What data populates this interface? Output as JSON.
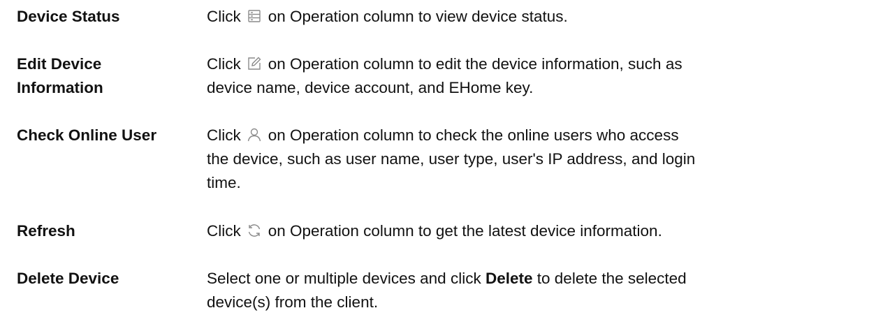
{
  "rows": [
    {
      "term": "Device Status",
      "pre": "Click",
      "icon": "device-status-icon",
      "post": "on Operation column to view device status."
    },
    {
      "term_line1": "Edit Device",
      "term_line2": "Information",
      "pre": "Click",
      "icon": "edit-icon",
      "post_line1": "on Operation column to edit the device information, such as",
      "line2": "device name, device account, and EHome key."
    },
    {
      "term": "Check Online User",
      "pre": "Click",
      "icon": "user-icon",
      "post_line1": "on Operation column to check the online users who access",
      "line2": "the device, such as user name, user type, user's IP address, and login",
      "line3": "time."
    },
    {
      "term": "Refresh",
      "pre": "Click",
      "icon": "refresh-icon",
      "post": "on Operation column to get the latest device information."
    },
    {
      "term": "Delete Device",
      "line1_pre": "Select one or multiple devices and click",
      "line1_bold": "Delete",
      "line1_post": "to delete the selected",
      "line2": "device(s) from the client."
    }
  ],
  "colors": {
    "text": "#111111",
    "icon": "#8a8a8a",
    "background": "#ffffff"
  }
}
